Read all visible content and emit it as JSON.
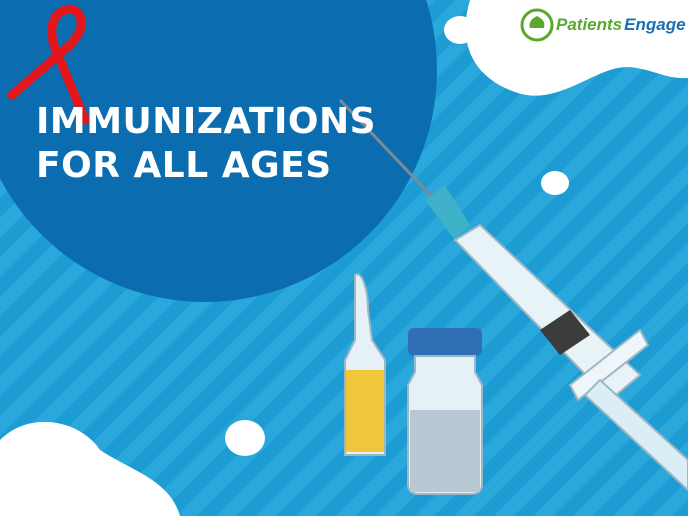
{
  "title": {
    "line1": "IMMUNIZATIONS",
    "line2": "FOR ALL AGES"
  },
  "logo": {
    "part1": "Patients",
    "part2": "Engage"
  },
  "colors": {
    "circle": "#0b6db0",
    "ribbon": "#e3161b",
    "liquid": "#f0c63a",
    "cap": "#2f6fb6"
  }
}
